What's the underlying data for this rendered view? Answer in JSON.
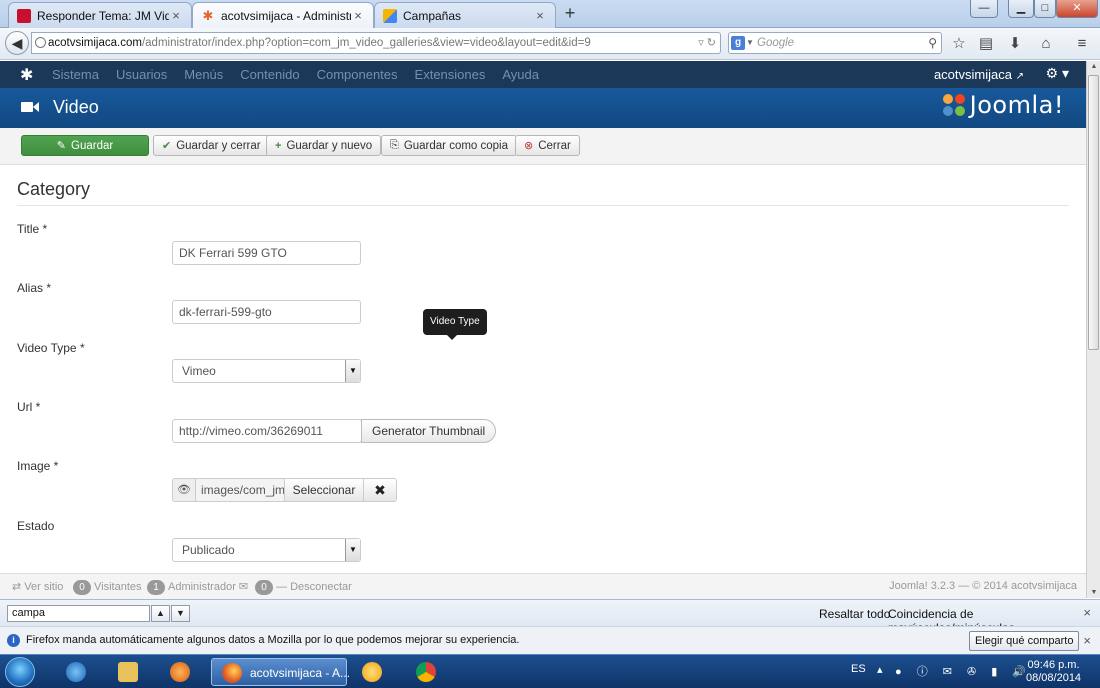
{
  "browser": {
    "tabs": [
      {
        "label": "Responder Tema: JM Video...",
        "favicon": "red-square",
        "active": false
      },
      {
        "label": "acotvsimijaca - Administra...",
        "favicon": "joomla",
        "active": true
      },
      {
        "label": "Campañas",
        "favicon": "adwords",
        "active": false
      }
    ],
    "new_tab": "+",
    "url_host": "acotvsimijaca.com",
    "url_path": "/administrator/index.php?option=com_jm_video_galleries&view=video&layout=edit&id=9",
    "search_engine": "g",
    "search_placeholder": "Google"
  },
  "joomla": {
    "menu": [
      "Sistema",
      "Usuarios",
      "Menús",
      "Contenido",
      "Componentes",
      "Extensiones",
      "Ayuda"
    ],
    "user": "acotvsimijaca",
    "page_title": "Video",
    "brand": "Joomla!",
    "toolbar": {
      "save": "Guardar",
      "save_close": "Guardar y cerrar",
      "save_new": "Guardar y nuevo",
      "save_copy": "Guardar como copia",
      "close": "Cerrar"
    },
    "form": {
      "legend": "Category",
      "title_label": "Title *",
      "title_value": "DK Ferrari 599 GTO",
      "alias_label": "Alias *",
      "alias_value": "dk-ferrari-599-gto",
      "video_type_label": "Video Type *",
      "video_type_value": "Vimeo",
      "url_label": "Url *",
      "url_value": "http://vimeo.com/36269011",
      "generator_button": "Generator Thumbnail",
      "image_label": "Image *",
      "image_path": "images/com_jm",
      "image_select": "Seleccionar",
      "image_clear": "✖",
      "estado_label": "Estado",
      "estado_value": "Publicado",
      "tooltip": "Video Type"
    },
    "status": {
      "view_site": "Ver sitio",
      "visitors_count": "0",
      "visitors": "Visitantes",
      "admin_count": "1",
      "admin": "Administrador",
      "messages_count": "0",
      "logout": "Desconectar",
      "version": "Joomla! 3.2.3 — © 2014 acotvsimijaca"
    }
  },
  "findbar": {
    "query": "campa",
    "highlight_all": "Resaltar todo",
    "match_case": "Coincidencia de mayúsculas/minúsculas"
  },
  "notification": {
    "text": "Firefox manda automáticamente algunos datos a Mozilla por lo que podemos mejorar su experiencia.",
    "button": "Elegir qué comparto"
  },
  "taskbar": {
    "active_app": "acotvsimijaca - A...",
    "lang": "ES",
    "time": "09:46 p.m.",
    "date": "08/08/2014"
  },
  "colors": {
    "joomla_nav": "#1b3858",
    "joomla_header": "#17599b",
    "save_green": "#51a351"
  }
}
